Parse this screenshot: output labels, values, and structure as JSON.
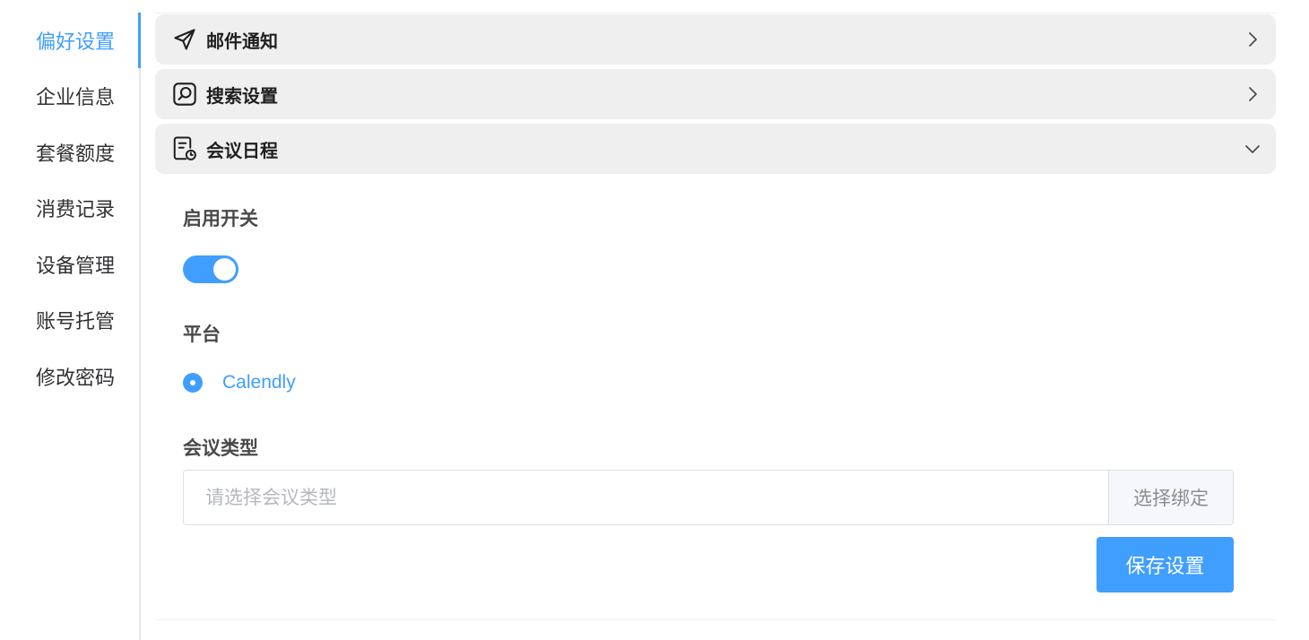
{
  "sidebar": {
    "items": [
      {
        "label": "偏好设置",
        "active": true
      },
      {
        "label": "企业信息"
      },
      {
        "label": "套餐额度"
      },
      {
        "label": "消费记录"
      },
      {
        "label": "设备管理"
      },
      {
        "label": "账号托管"
      },
      {
        "label": "修改密码"
      }
    ]
  },
  "panels": [
    {
      "title": "邮件通知",
      "icon": "send-icon",
      "expanded": false
    },
    {
      "title": "搜索设置",
      "icon": "search-box-icon",
      "expanded": false
    },
    {
      "title": "会议日程",
      "icon": "schedule-icon",
      "expanded": true
    }
  ],
  "meeting": {
    "enable_label": "启用开关",
    "enabled": true,
    "platform_label": "平台",
    "platform_option": "Calendly",
    "type_label": "会议类型",
    "type_placeholder": "请选择会议类型",
    "type_value": "",
    "bind_button": "选择绑定",
    "save_button": "保存设置"
  },
  "colors": {
    "accent": "#409eff",
    "panel_bg": "#efefef",
    "text": "#303133"
  }
}
